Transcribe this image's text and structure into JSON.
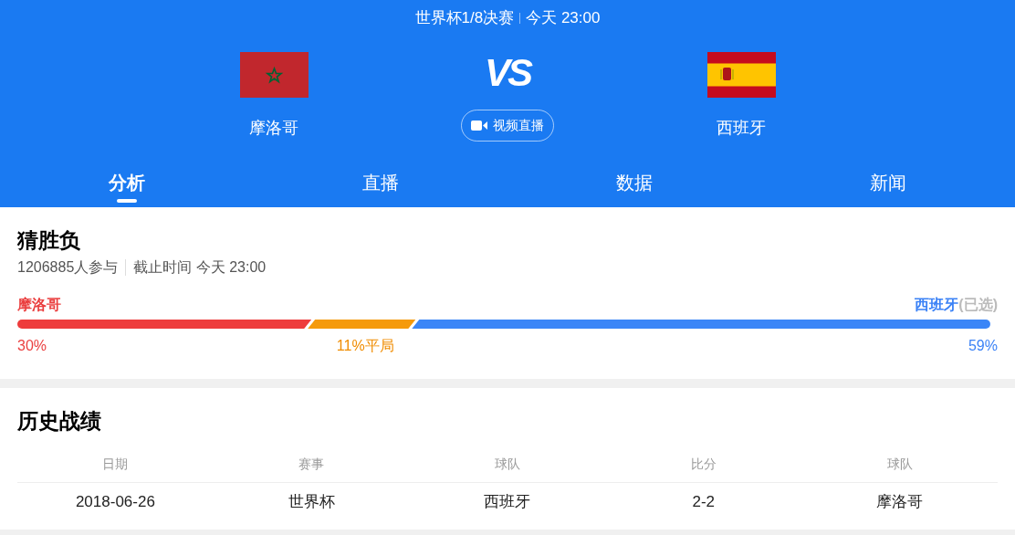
{
  "header": {
    "competition": "世界杯1/8决赛",
    "time": "今天 23:00",
    "vs": "VS",
    "home": {
      "name": "摩洛哥",
      "kind": "morocco"
    },
    "away": {
      "name": "西班牙",
      "kind": "spain"
    },
    "live_button": "视频直播"
  },
  "tabs": [
    {
      "label": "分析",
      "selected": true
    },
    {
      "label": "直播",
      "selected": false
    },
    {
      "label": "数据",
      "selected": false
    },
    {
      "label": "新闻",
      "selected": false
    }
  ],
  "guess": {
    "title": "猜胜负",
    "participants": "1206885人参与",
    "deadline": "截止时间 今天 23:00",
    "home": {
      "name": "摩洛哥",
      "reading": "30%"
    },
    "draw": {
      "reading": "11%平局"
    },
    "away": {
      "name": "西班牙",
      "selected": true,
      "note": "(已选)",
      "reading": "59%"
    }
  },
  "history": {
    "title": "历史战绩",
    "columns": [
      "日期",
      "赛事",
      "球队",
      "比分",
      "球队"
    ],
    "rows": [
      [
        "2018-06-26",
        "世界杯",
        "西班牙",
        "2-2",
        "摩洛哥"
      ]
    ]
  }
}
